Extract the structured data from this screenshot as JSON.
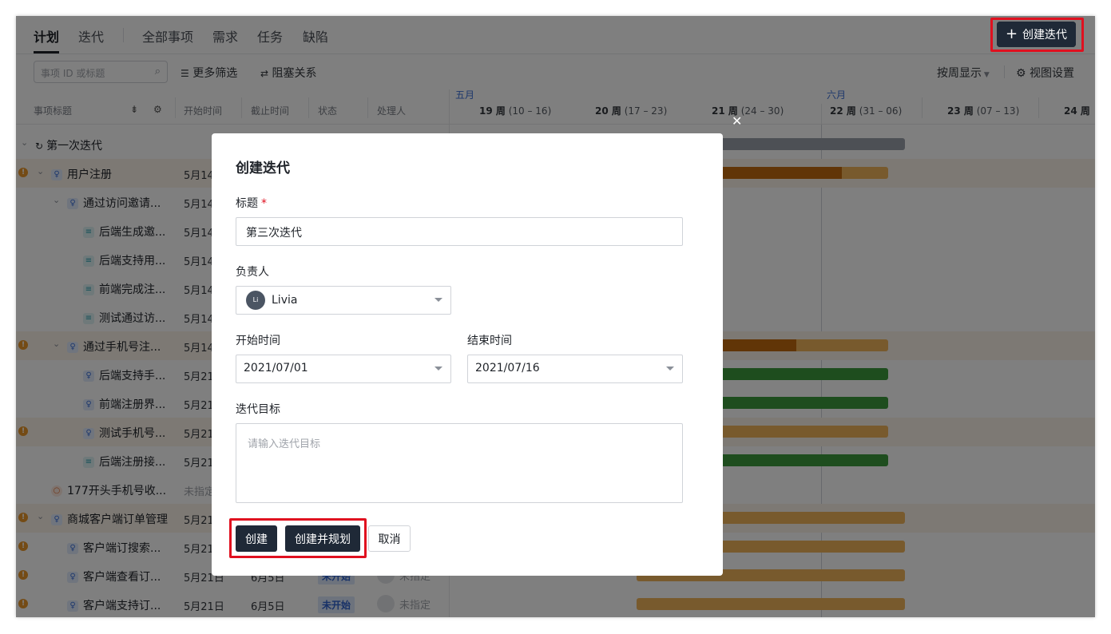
{
  "nav": {
    "tabs": [
      {
        "label": "计划"
      },
      {
        "label": "迭代"
      },
      {
        "label": "全部事项"
      },
      {
        "label": "需求"
      },
      {
        "label": "任务"
      },
      {
        "label": "缺陷"
      }
    ],
    "create_button": "创建迭代"
  },
  "filters": {
    "search_placeholder": "事项 ID 或标题",
    "more_filters": "更多筛选",
    "blocking": "阻塞关系",
    "by_week": "按周显示",
    "view_settings": "视图设置"
  },
  "columns": {
    "title": "事项标题",
    "start": "开始时间",
    "end": "截止时间",
    "status": "状态",
    "assignee": "处理人"
  },
  "timeline": {
    "months": [
      "五月",
      "六月"
    ],
    "weeks": [
      {
        "num": "19 周",
        "range": "(10 – 16)"
      },
      {
        "num": "20 周",
        "range": "(17 – 23)"
      },
      {
        "num": "21 周",
        "range": "(24 – 30)"
      },
      {
        "num": "22 周",
        "range": "(31 – 06)"
      },
      {
        "num": "23 周",
        "range": "(07 – 13)"
      },
      {
        "num": "24 周",
        "range": ""
      }
    ]
  },
  "rows": [
    {
      "title": "第一次迭代",
      "start": "",
      "end": "",
      "status": "",
      "assignee": ""
    },
    {
      "title": "用户注册",
      "start": "5月14",
      "end": "",
      "status": "",
      "assignee": ""
    },
    {
      "title": "通过访问邀请...",
      "start": "5月14",
      "end": "",
      "status": "",
      "assignee": ""
    },
    {
      "title": "后端生成邀...",
      "start": "5月14",
      "end": "",
      "status": "",
      "assignee": ""
    },
    {
      "title": "后端支持用...",
      "start": "5月14",
      "end": "",
      "status": "",
      "assignee": ""
    },
    {
      "title": "前端完成注...",
      "start": "5月14",
      "end": "",
      "status": "",
      "assignee": ""
    },
    {
      "title": "测试通过访...",
      "start": "5月14",
      "end": "",
      "status": "",
      "assignee": ""
    },
    {
      "title": "通过手机号注...",
      "start": "5月14",
      "end": "",
      "status": "",
      "assignee": ""
    },
    {
      "title": "后端支持手...",
      "start": "5月21",
      "end": "",
      "status": "",
      "assignee": ""
    },
    {
      "title": "前端注册界...",
      "start": "5月21",
      "end": "",
      "status": "",
      "assignee": ""
    },
    {
      "title": "测试手机号...",
      "start": "5月21",
      "end": "",
      "status": "",
      "assignee": ""
    },
    {
      "title": "后端注册接...",
      "start": "5月21",
      "end": "",
      "status": "",
      "assignee": ""
    },
    {
      "title": "177开头手机号收...",
      "start": "未指定",
      "end": "",
      "status": "",
      "assignee": ""
    },
    {
      "title": "商城客户端订单管理",
      "start": "5月21",
      "end": "",
      "status": "",
      "assignee": ""
    },
    {
      "title": "客户端订搜索...",
      "start": "5月21",
      "end": "",
      "status": "",
      "assignee": ""
    },
    {
      "title": "客户端查看订...",
      "start": "5月21日",
      "end": "6月5日",
      "status": "未开始",
      "assignee": "未指定"
    },
    {
      "title": "客户端支持订...",
      "start": "5月21日",
      "end": "6月5日",
      "status": "未开始",
      "assignee": "未指定"
    }
  ],
  "modal": {
    "title": "创建迭代",
    "title_label": "标题",
    "title_value": "第三次迭代",
    "owner_label": "负责人",
    "owner_value": "Livia",
    "owner_initials": "Li",
    "start_label": "开始时间",
    "start_value": "2021/07/01",
    "end_label": "结束时间",
    "end_value": "2021/07/16",
    "goal_label": "迭代目标",
    "goal_placeholder": "请输入迭代目标",
    "btn_create": "创建",
    "btn_create_plan": "创建并规划",
    "btn_cancel": "取消"
  }
}
